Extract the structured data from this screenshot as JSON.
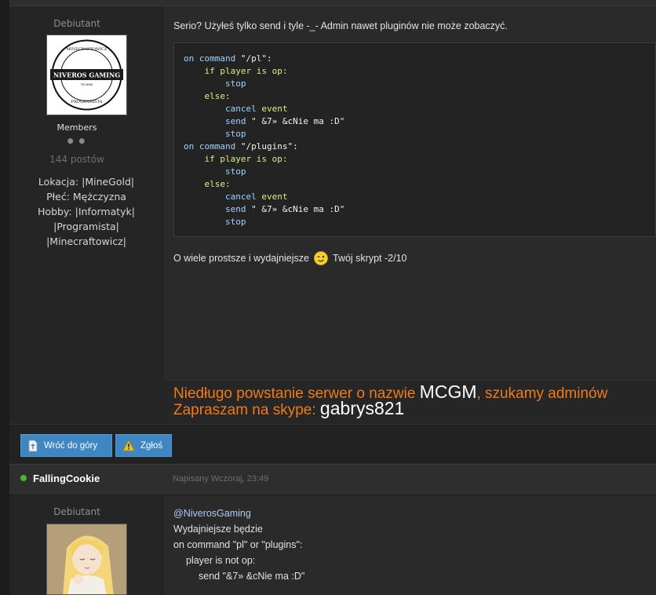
{
  "post1": {
    "author": {
      "rank": "Debiutant",
      "avatar": {
        "logo_text": "NIVEROS GAMING",
        "ring_top": "MINECRAFTOWICZ",
        "ring_bottom": "PROGRAMISTA",
        "ring_middle": "TECHNIK"
      },
      "group": "Members",
      "pips": "● ●",
      "post_count": "144 postów",
      "fields": [
        "Lokacja: |MineGold|",
        "Płeć: Mężczyzna",
        "Hobby: |Informatyk|",
        "|Programista|",
        "|Minecraftowicz|"
      ]
    },
    "intro": "Serio? Użyłeś tylko send i tyle -_- Admin nawet pluginów nie może zobaczyć.",
    "code": [
      "on command \"/pl\":",
      "    if player is op:",
      "        stop",
      "    else:",
      "        cancel event",
      "        send \" &7» &cNie ma :D\"",
      "        stop",
      "on command \"/plugins\":",
      "    if player is op:",
      "        stop",
      "    else:",
      "        cancel event",
      "        send \" &7» &cNie ma :D\"",
      "        stop"
    ],
    "outro_before": "O wiele prostsze i wydajniejsze",
    "outro_after": "Twój skrypt -2/10",
    "signature": {
      "line1_orange": "Niedługo powstanie serwer o nazwie ",
      "line1_white": "MCGM",
      "line1_orange2": ", szukamy adminów",
      "line2_orange": "Zapraszam na skype: ",
      "line2_white": "gabrys821"
    },
    "buttons": {
      "back_to_top": "Wróć do góry",
      "report": "Zgłoś"
    }
  },
  "post2": {
    "username": "FallingCookie",
    "posted": "Napisany Wczoraj, 23:49",
    "author": {
      "rank": "Debiutant"
    },
    "lines": [
      "@NiverosGaming",
      "Wydajniejsze będzie",
      "on command \"pl\" or \"plugins\":",
      "player is not op:",
      "send \"&7» &cNie ma :D\""
    ]
  },
  "colors": {
    "accent_button": "#3f86c4",
    "signature_orange": "#f07b1c",
    "online_green": "#4cb535",
    "mention_blue": "#a8cdf0"
  }
}
